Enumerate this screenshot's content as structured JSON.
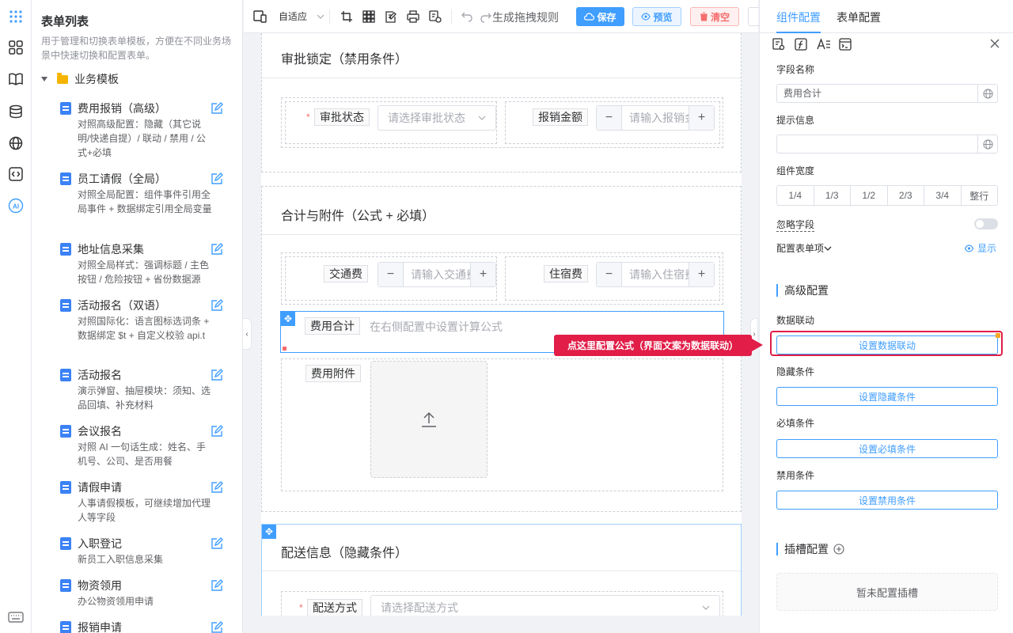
{
  "rail": {
    "icons": [
      "apps-grid-icon",
      "layout-icon",
      "book-icon",
      "database-icon",
      "globe-icon",
      "code-icon",
      "ai-icon",
      "keyboard-icon"
    ]
  },
  "template_panel": {
    "title": "表单列表",
    "description": "用于管理和切换表单模板，方便在不同业务场景中快速切换和配置表单。",
    "group": "业务模板",
    "items": [
      {
        "title": "费用报销（高级）",
        "desc": "对照高级配置：隐藏（其它说明/快递自提）/ 联动 / 禁用 / 公式+必填"
      },
      {
        "title": "员工请假（全局）",
        "desc": "对照全局配置：组件事件引用全局事件 + 数据绑定引用全局变量"
      },
      {
        "title": "地址信息采集",
        "desc": "对照全局样式：强调标题 / 主色按钮 / 危险按钮 + 省份数据源"
      },
      {
        "title": "活动报名（双语）",
        "desc": "对照国际化：语言图标选词条 + 数据绑定 $t + 自定义校验 api.t"
      },
      {
        "title": "活动报名",
        "desc": "演示弹窗、抽屉模块：须知、选品回填、补充材料"
      },
      {
        "title": "会议报名",
        "desc": "对照 AI 一句话生成：姓名、手机号、公司、是否用餐"
      },
      {
        "title": "请假申请",
        "desc": "人事请假模板，可继续增加代理人等字段"
      },
      {
        "title": "入职登记",
        "desc": "新员工入职信息采集"
      },
      {
        "title": "物资领用",
        "desc": "办公物资领用申请"
      },
      {
        "title": "报销申请",
        "desc": ""
      }
    ]
  },
  "toolbar": {
    "adapt": "自适应",
    "gen_rules": "生成拖拽规则",
    "save": "保存",
    "preview": "预览",
    "clear": "清空"
  },
  "canvas": {
    "sec1": {
      "title": "审批锁定（禁用条件）",
      "label1": "审批状态",
      "ph1": "请选择审批状态",
      "label2": "报销金额",
      "ph2": "请输入报销金额"
    },
    "sec2": {
      "title": "合计与附件（公式 + 必填）",
      "label1": "交通费",
      "ph1": "请输入交通费",
      "label2": "住宿费",
      "ph2": "请输入住宿费",
      "total_label": "费用合计",
      "total_hint": "在右侧配置中设置计算公式",
      "attach_label": "费用附件"
    },
    "sec3": {
      "title": "配送信息（隐藏条件）",
      "label1": "配送方式",
      "ph1": "请选择配送方式"
    }
  },
  "callout": "点这里配置公式（界面文案为数据联动）",
  "right_panel": {
    "tab1": "组件配置",
    "tab2": "表单配置",
    "field_name_label": "字段名称",
    "field_name_value": "费用合计",
    "hint_label": "提示信息",
    "width_label": "组件宽度",
    "widths": [
      "1/4",
      "1/3",
      "1/2",
      "2/3",
      "3/4",
      "整行"
    ],
    "ignore_label": "忽略字段",
    "config_items_label": "配置表单项",
    "show_label": "显示",
    "advanced_title": "高级配置",
    "linkage_label": "数据联动",
    "linkage_btn": "设置数据联动",
    "hidden_label": "隐藏条件",
    "hidden_btn": "设置隐藏条件",
    "required_label": "必填条件",
    "required_btn": "设置必填条件",
    "disabled_label": "禁用条件",
    "disabled_btn": "设置禁用条件",
    "slot_title": "插槽配置",
    "slot_empty": "暂未配置插槽"
  },
  "colors": {
    "primary": "#409eff",
    "danger": "#f56c6c",
    "callout": "#e11d48"
  }
}
